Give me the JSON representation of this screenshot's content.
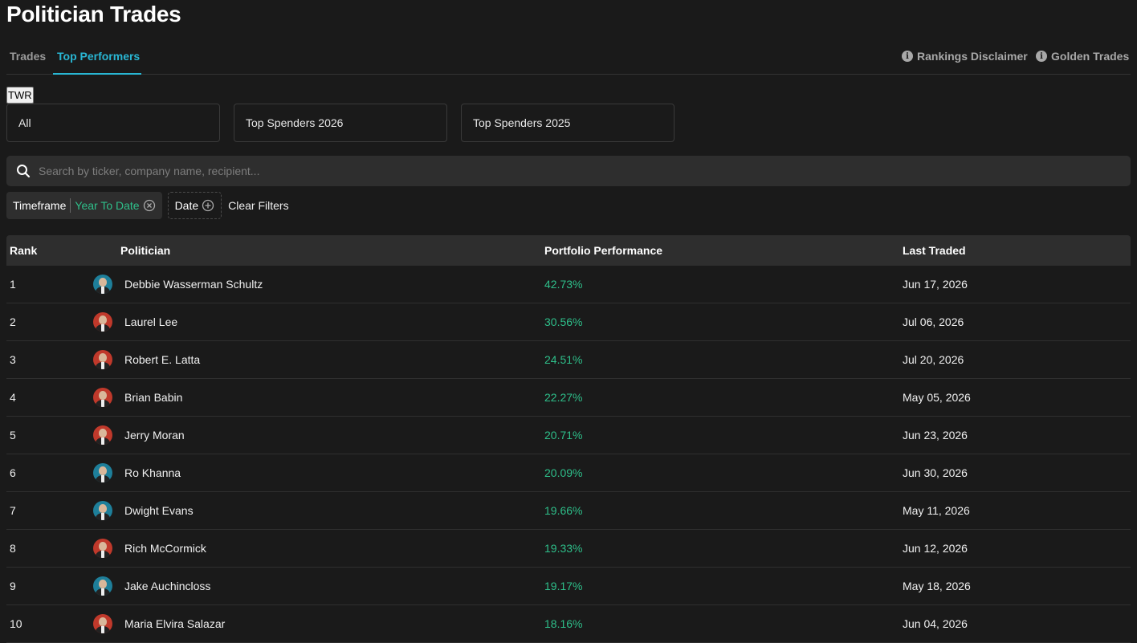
{
  "page_title": "Politician Trades",
  "tabs": [
    "Trades",
    "Top Performers"
  ],
  "header_links": [
    "Rankings Disclaimer",
    "Golden Trades"
  ],
  "twr_label": "TWR",
  "cards": [
    "All",
    "Top Spenders 2026",
    "Top Spenders 2025"
  ],
  "search": {
    "placeholder": "Search by ticker, company name, recipient..."
  },
  "filters": {
    "timeframe_label": "Timeframe",
    "timeframe_value": "Year To Date",
    "date_label": "Date",
    "clear_label": "Clear Filters"
  },
  "table": {
    "headers": [
      "Rank",
      "Politician",
      "Portfolio Performance",
      "Last Traded"
    ],
    "rows": [
      {
        "rank": "1",
        "name": "Debbie Wasserman Schultz",
        "performance": "42.73%",
        "last_traded": "Jun 17, 2026",
        "party_color": "#1e7f9a"
      },
      {
        "rank": "2",
        "name": "Laurel Lee",
        "performance": "30.56%",
        "last_traded": "Jul 06, 2026",
        "party_color": "#c0392b"
      },
      {
        "rank": "3",
        "name": "Robert E. Latta",
        "performance": "24.51%",
        "last_traded": "Jul 20, 2026",
        "party_color": "#c0392b"
      },
      {
        "rank": "4",
        "name": "Brian Babin",
        "performance": "22.27%",
        "last_traded": "May 05, 2026",
        "party_color": "#c0392b"
      },
      {
        "rank": "5",
        "name": "Jerry Moran",
        "performance": "20.71%",
        "last_traded": "Jun 23, 2026",
        "party_color": "#c0392b"
      },
      {
        "rank": "6",
        "name": "Ro Khanna",
        "performance": "20.09%",
        "last_traded": "Jun 30, 2026",
        "party_color": "#1e7f9a"
      },
      {
        "rank": "7",
        "name": "Dwight Evans",
        "performance": "19.66%",
        "last_traded": "May 11, 2026",
        "party_color": "#1e7f9a"
      },
      {
        "rank": "8",
        "name": "Rich McCormick",
        "performance": "19.33%",
        "last_traded": "Jun 12, 2026",
        "party_color": "#c0392b"
      },
      {
        "rank": "9",
        "name": "Jake Auchincloss",
        "performance": "19.17%",
        "last_traded": "May 18, 2026",
        "party_color": "#1e7f9a"
      },
      {
        "rank": "10",
        "name": "Maria Elvira Salazar",
        "performance": "18.16%",
        "last_traded": "Jun 04, 2026",
        "party_color": "#c0392b"
      }
    ]
  },
  "colors": {
    "accent": "#29b6d3",
    "positive": "#2ebf8a",
    "background": "#1a1a1a"
  }
}
